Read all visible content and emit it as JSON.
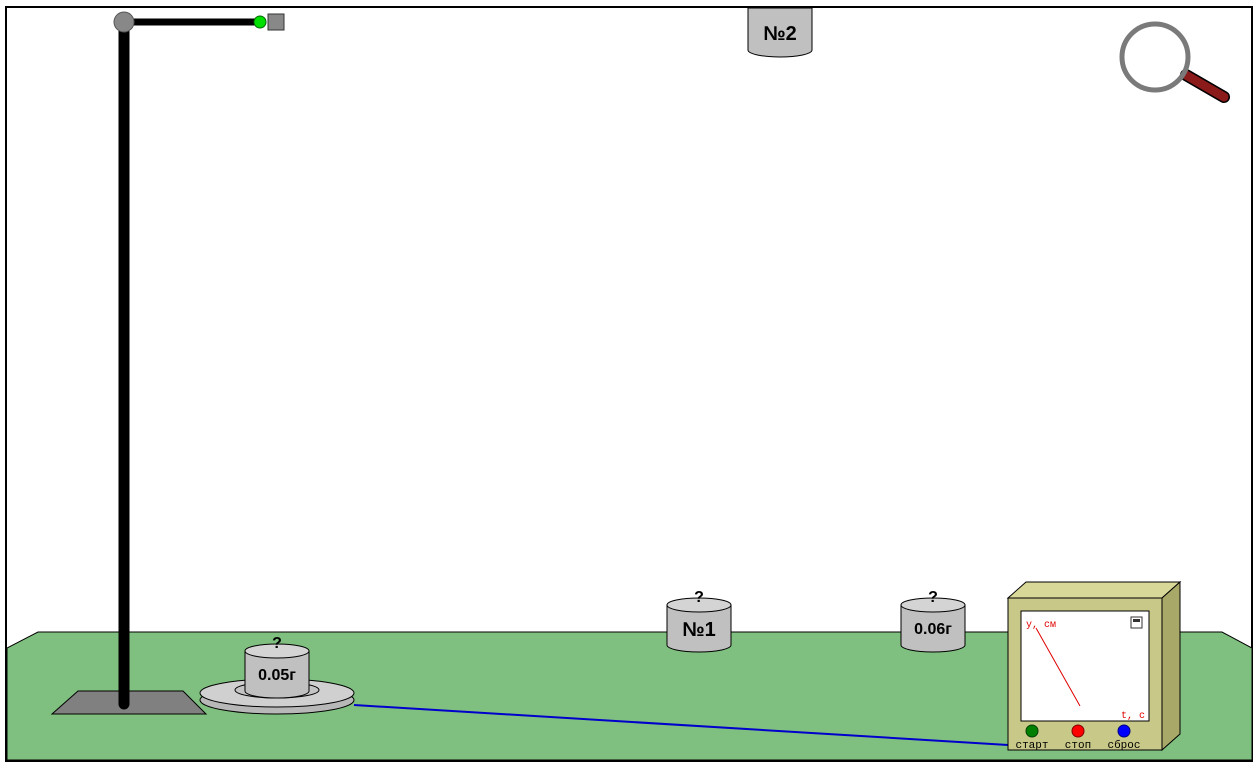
{
  "weights": {
    "w1": {
      "label": "№1",
      "hook": "?"
    },
    "w2": {
      "label": "№2"
    },
    "w005": {
      "label": "0.05г",
      "hook": "?"
    },
    "w006": {
      "label": "0.06г",
      "hook": "?"
    }
  },
  "device": {
    "y_axis_label": "y, см",
    "x_axis_label": "t, с",
    "start_label": "старт",
    "stop_label": "стоп",
    "reset_label": "сброс"
  },
  "colors": {
    "ground": "#7fbf7f",
    "device_body": "#c8c888",
    "start_button": "#008000",
    "stop_button": "#ff0000",
    "reset_button": "#0000ff",
    "wire": "#0000cc",
    "graph_line": "#e00000",
    "magnifier_handle": "#8b1a1a"
  },
  "icons": {
    "magnifier": "magnifier-icon",
    "window": "window-icon"
  }
}
